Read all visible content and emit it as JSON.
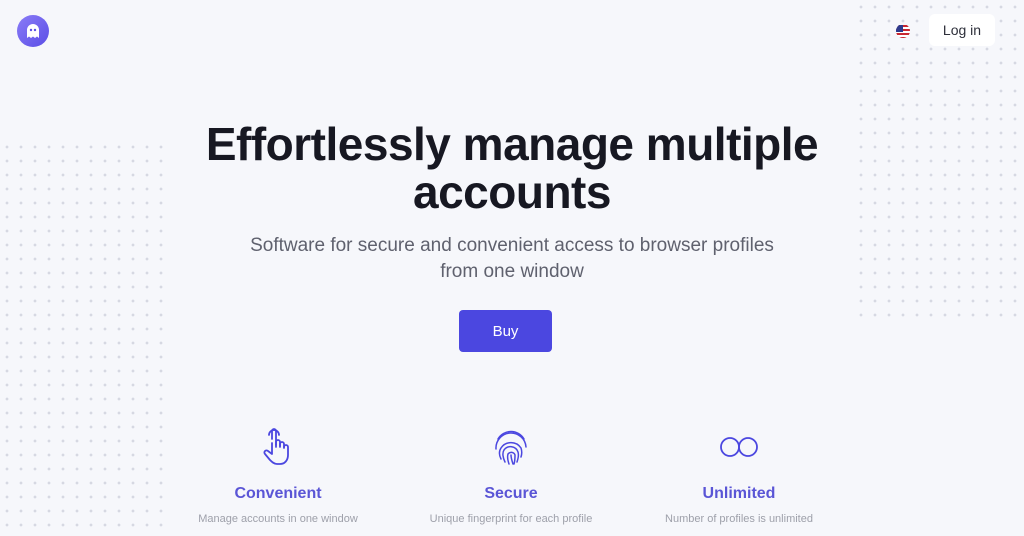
{
  "header": {
    "logo_icon": "ghost-icon",
    "language_flag_icon": "us-flag-icon",
    "login_label": "Log in"
  },
  "hero": {
    "title_line1": "Effortlessly manage multiple",
    "title_line2": "accounts",
    "subtitle_line1": "Software for secure and convenient access to browser profiles",
    "subtitle_line2": "from one window",
    "buy_label": "Buy"
  },
  "features": [
    {
      "icon": "tap-hand-icon",
      "title": "Convenient",
      "description": "Manage accounts in one window"
    },
    {
      "icon": "fingerprint-icon",
      "title": "Secure",
      "description": "Unique fingerprint for each profile"
    },
    {
      "icon": "infinity-icon",
      "title": "Unlimited",
      "description": "Number of profiles is unlimited"
    }
  ],
  "colors": {
    "accent": "#4b47e0",
    "feature_title": "#5a55d6",
    "background": "#f6f7fb"
  }
}
